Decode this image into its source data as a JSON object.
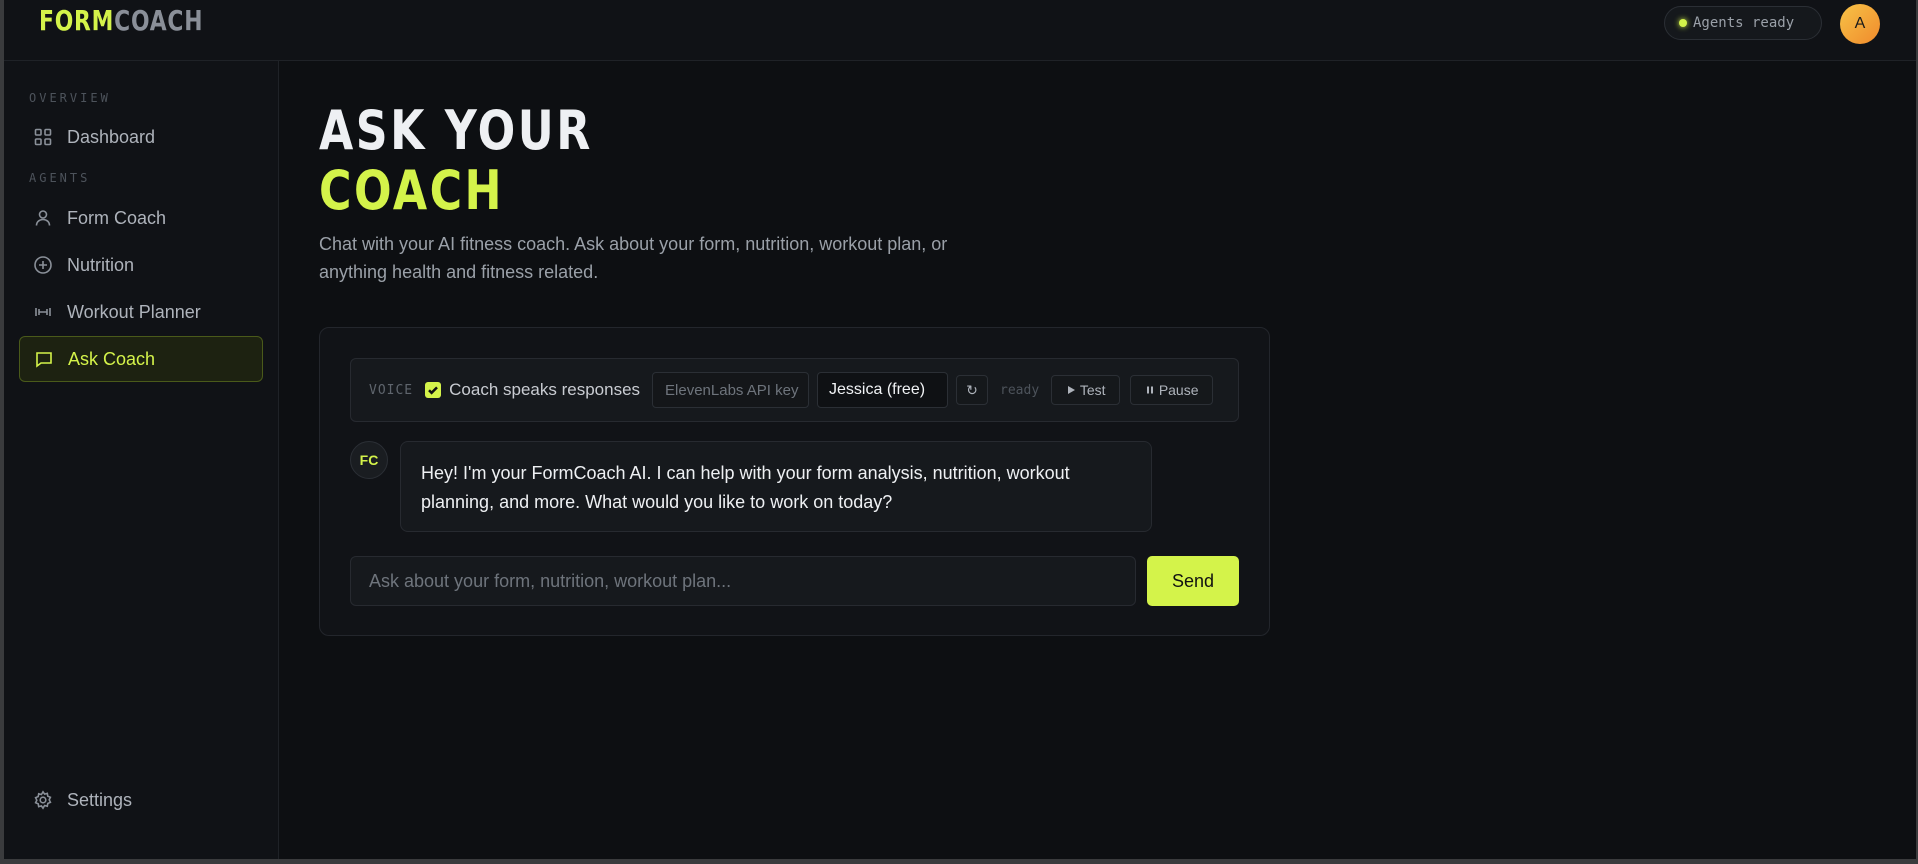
{
  "header": {
    "logo_part1": "FORM",
    "logo_part2": "COACH",
    "status": "Agents ready",
    "avatar_initial": "A"
  },
  "sidebar": {
    "section_overview": "OVERVIEW",
    "section_agents": "AGENTS",
    "items": [
      {
        "label": "Dashboard",
        "icon": "grid-icon"
      },
      {
        "label": "Form Coach",
        "icon": "user-icon"
      },
      {
        "label": "Nutrition",
        "icon": "plus-circle-icon"
      },
      {
        "label": "Workout Planner",
        "icon": "dumbbell-icon"
      },
      {
        "label": "Ask Coach",
        "icon": "chat-icon",
        "active": true
      }
    ],
    "settings_label": "Settings"
  },
  "main": {
    "title_line1": "ASK YOUR",
    "title_line2": "COACH",
    "subtitle": "Chat with your AI fitness coach. Ask about your form, nutrition, workout plan, or anything health and fitness related."
  },
  "voice": {
    "label": "VOICE",
    "speaks_checked": true,
    "speaks_label": "Coach speaks responses",
    "api_key_placeholder": "ElevenLabs API key",
    "voice_selected": "Jessica (free)",
    "refresh_symbol": "↻",
    "status": "ready",
    "test_label": "Test",
    "pause_label": "Pause"
  },
  "chat": {
    "coach_initials": "FC",
    "messages": [
      {
        "from": "coach",
        "text": "Hey! I'm your FormCoach AI. I can help with your form analysis, nutrition, workout planning, and more. What would you like to work on today?"
      }
    ],
    "input_placeholder": "Ask about your form, nutrition, workout plan...",
    "send_label": "Send"
  },
  "colors": {
    "accent": "#d4f34a",
    "background": "#0d0f12",
    "sidebar": "#101216"
  }
}
